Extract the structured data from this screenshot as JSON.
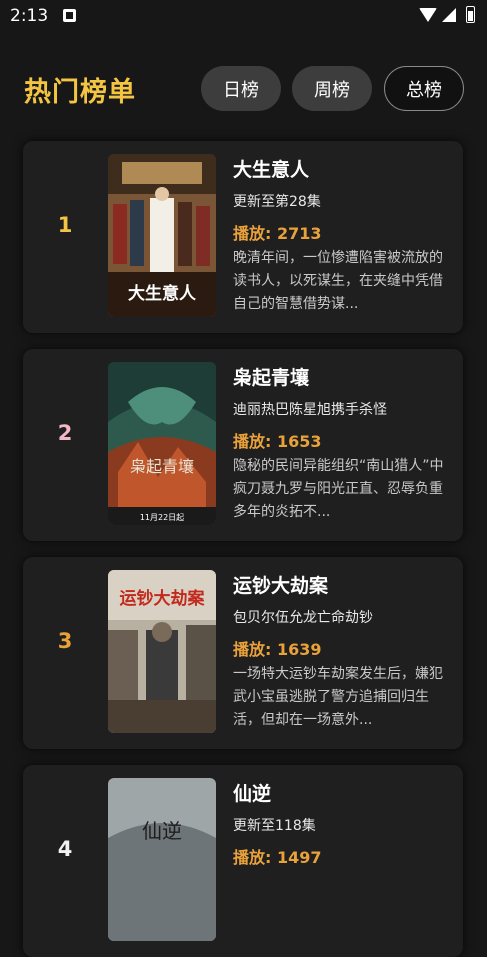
{
  "status_bar": {
    "time": "2:13"
  },
  "header": {
    "title": "热门榜单",
    "tabs": [
      {
        "label": "日榜"
      },
      {
        "label": "周榜"
      },
      {
        "label": "总榜"
      }
    ]
  },
  "colors": {
    "accent_title": "#f4c542",
    "plays": "#e9a23b",
    "rank_1": "#f4c542",
    "rank_2": "#f2b8c6",
    "rank_3": "#e9a23b",
    "rank_4": "#f2f2f2"
  },
  "list": [
    {
      "rank": "1",
      "title": "大生意人",
      "subtitle": "更新至第28集",
      "plays": "播放: 2713",
      "desc": "晚清年间，一位惨遭陷害被流放的读书人，以死谋生，在夹缝中凭借自己的智慧借势谋..."
    },
    {
      "rank": "2",
      "title": "枭起青壤",
      "subtitle": "迪丽热巴陈星旭携手杀怪",
      "plays": "播放: 1653",
      "desc": "隐秘的民间异能组织“南山猎人”中疯刀聂九罗与阳光正直、忍辱负重多年的炎拓不..."
    },
    {
      "rank": "3",
      "title": "运钞大劫案",
      "subtitle": "包贝尔伍允龙亡命劫钞",
      "plays": "播放: 1639",
      "desc": "一场特大运钞车劫案发生后，嫌犯武小宝虽逃脱了警方追捕回归生活，但却在一场意外..."
    },
    {
      "rank": "4",
      "title": "仙逆",
      "subtitle": "更新至118集",
      "plays": "播放: 1497",
      "desc": ""
    }
  ]
}
